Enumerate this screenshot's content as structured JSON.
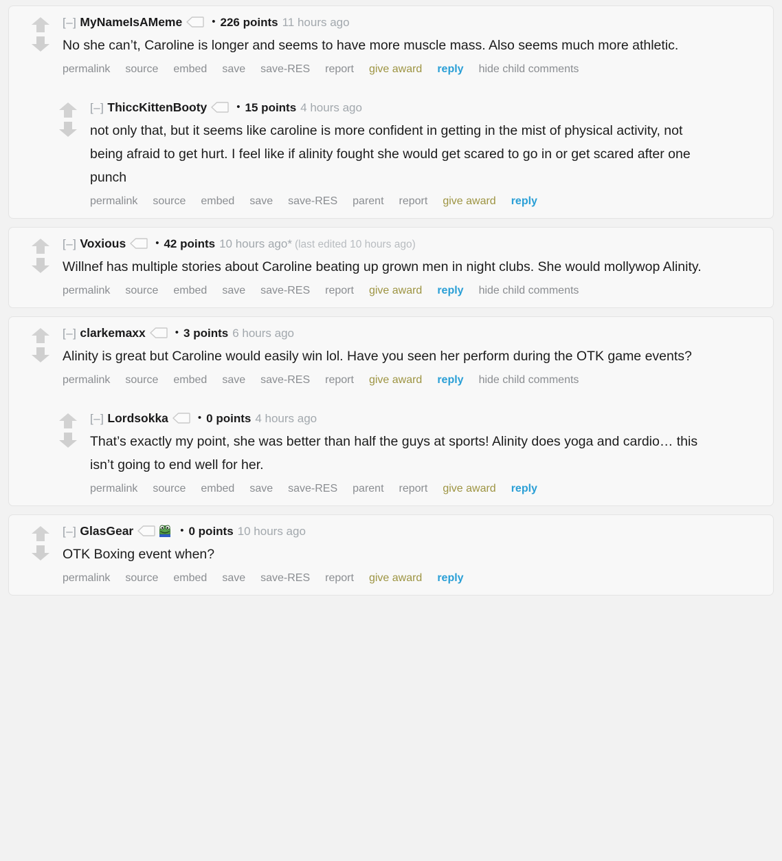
{
  "page": {
    "platform": "reddit-comment-thread",
    "background_color": "#f2f2f2",
    "card_color": "#f8f8f8",
    "accent_reply_color": "#2a9fd6",
    "accent_award_color": "#9d9442",
    "meta_text_color": "#a2a8ad"
  },
  "icons": {
    "upvote": "upvote-arrow-icon",
    "downvote": "downvote-arrow-icon",
    "user_tag": "user-tag-icon",
    "collapse": "[–]",
    "bullet": "•"
  },
  "labels": {
    "permalink": "permalink",
    "source": "source",
    "embed": "embed",
    "save": "save",
    "save_res": "save-RES",
    "parent": "parent",
    "report": "report",
    "give_award": "give award",
    "reply": "reply",
    "hide_child_comments": "hide child comments"
  },
  "cards": [
    {
      "id": "card-1",
      "comments": [
        {
          "id": "comment-mynameisameme",
          "nested": false,
          "collapse": "[–]",
          "username": "MyNameIsAMeme",
          "has_tag_icon": true,
          "flair_emoji": null,
          "bullet": "•",
          "points": "226 points",
          "when": "11 hours ago",
          "edited": "",
          "body": "No she can’t, Caroline is longer and seems to have more muscle mass. Also seems much more athletic.",
          "actions": [
            "permalink",
            "source",
            "embed",
            "save",
            "save-RES",
            "report",
            "give award",
            "reply",
            "hide child comments"
          ]
        },
        {
          "id": "comment-thicckittenbooty",
          "nested": true,
          "collapse": "[–]",
          "username": "ThiccKittenBooty",
          "has_tag_icon": true,
          "flair_emoji": null,
          "bullet": "•",
          "points": "15 points",
          "when": "4 hours ago",
          "edited": "",
          "body": "not only that, but it seems like caroline is more confident in getting in the mist of physical activity, not being afraid to get hurt. I feel like if alinity fought she would get scared to go in or get scared after one punch",
          "actions": [
            "permalink",
            "source",
            "embed",
            "save",
            "save-RES",
            "parent",
            "report",
            "give award",
            "reply"
          ]
        }
      ]
    },
    {
      "id": "card-2",
      "comments": [
        {
          "id": "comment-voxious",
          "nested": false,
          "collapse": "[–]",
          "username": "Voxious",
          "has_tag_icon": true,
          "flair_emoji": null,
          "bullet": "•",
          "points": "42 points",
          "when": "10 hours ago*",
          "edited": "(last edited 10 hours ago)",
          "body": "Willnef has multiple stories about Caroline beating up grown men in night clubs. She would mollywop Alinity.",
          "actions": [
            "permalink",
            "source",
            "embed",
            "save",
            "save-RES",
            "report",
            "give award",
            "reply",
            "hide child comments"
          ]
        }
      ]
    },
    {
      "id": "card-3",
      "comments": [
        {
          "id": "comment-clarkemaxx",
          "nested": false,
          "collapse": "[–]",
          "username": "clarkemaxx",
          "has_tag_icon": true,
          "flair_emoji": null,
          "bullet": "•",
          "points": "3 points",
          "when": "6 hours ago",
          "edited": "",
          "body": "Alinity is great but Caroline would easily win lol. Have you seen her perform during the OTK game events?",
          "actions": [
            "permalink",
            "source",
            "embed",
            "save",
            "save-RES",
            "report",
            "give award",
            "reply",
            "hide child comments"
          ]
        },
        {
          "id": "comment-lordsokka",
          "nested": true,
          "collapse": "[–]",
          "username": "Lordsokka",
          "has_tag_icon": true,
          "flair_emoji": null,
          "bullet": "•",
          "points": "0 points",
          "when": "4 hours ago",
          "edited": "",
          "body": "That’s exactly my point, she was better than half the guys at sports! Alinity does yoga and cardio… this isn’t going to end well for her.",
          "actions": [
            "permalink",
            "source",
            "embed",
            "save",
            "save-RES",
            "parent",
            "report",
            "give award",
            "reply"
          ]
        }
      ]
    },
    {
      "id": "card-4",
      "comments": [
        {
          "id": "comment-glasgear",
          "nested": false,
          "collapse": "[–]",
          "username": "GlasGear",
          "has_tag_icon": true,
          "flair_emoji": "pepe-frog-flair",
          "bullet": "•",
          "points": "0 points",
          "when": "10 hours ago",
          "edited": "",
          "body": "OTK Boxing event when?",
          "actions": [
            "permalink",
            "source",
            "embed",
            "save",
            "save-RES",
            "report",
            "give award",
            "reply"
          ]
        }
      ]
    }
  ]
}
